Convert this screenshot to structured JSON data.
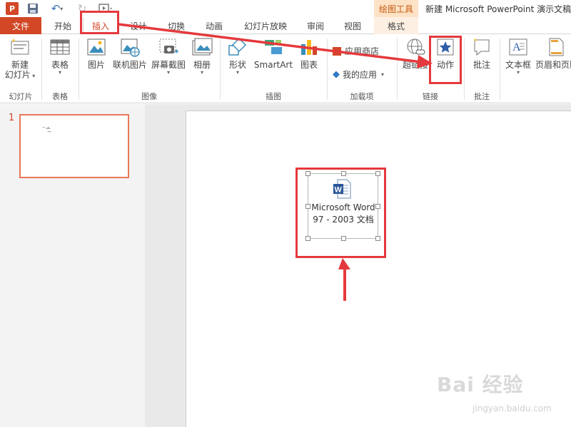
{
  "titlebar": {
    "app_logo": "P",
    "context_tools_label": "绘图工具",
    "document_title": "新建 Microsoft PowerPoint 演示文稿"
  },
  "tabs": [
    {
      "label": "文件"
    },
    {
      "label": "开始"
    },
    {
      "label": "插入"
    },
    {
      "label": "设计"
    },
    {
      "label": "切换"
    },
    {
      "label": "动画"
    },
    {
      "label": "幻灯片放映"
    },
    {
      "label": "审阅"
    },
    {
      "label": "视图"
    },
    {
      "label": "格式"
    }
  ],
  "ribbon": {
    "new_slide_line1": "新建",
    "new_slide_line2": "幻灯片",
    "group_slides": "幻灯片",
    "table": "表格",
    "group_tables": "表格",
    "picture": "图片",
    "online_picture": "联机图片",
    "screenshot": "屏幕截图",
    "album": "相册",
    "group_images": "图像",
    "shapes": "形状",
    "smartart": "SmartArt",
    "chart": "图表",
    "group_illustrations": "插图",
    "app_store": "应用商店",
    "my_apps": "我的应用",
    "group_addins": "加载项",
    "hyperlink": "超链接",
    "action": "动作",
    "group_links": "链接",
    "comment": "批注",
    "group_comments": "批注",
    "textbox": "文本框",
    "header_footer": "页眉和页脚"
  },
  "thumbs": {
    "slide_number": "1",
    "mark": "⁻∸̲"
  },
  "object": {
    "line1": "Microsoft Word",
    "line2": "97 - 2003 文档",
    "icon_letter": "W"
  },
  "colors": {
    "accent": "#d24726",
    "highlight": "#e4393c"
  },
  "watermark": {
    "main": "Bai 经验",
    "sub": "jingyan.baidu.com"
  }
}
